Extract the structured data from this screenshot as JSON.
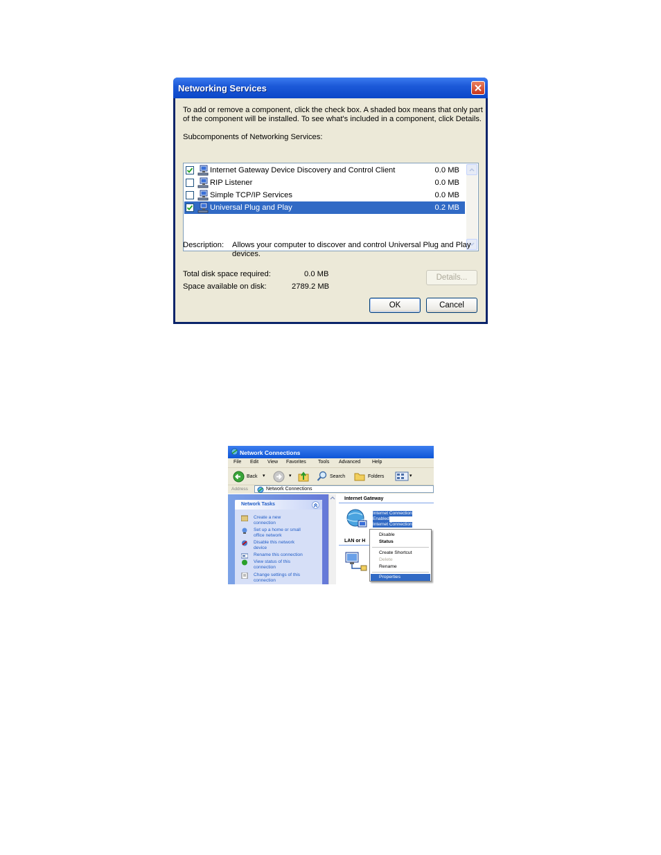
{
  "dialog": {
    "title": "Networking Services",
    "intro_line1": "To add or remove a component, click the check box. A shaded box means that only part",
    "intro_line2": "of the component will be installed. To see what's included in a component, click Details.",
    "subcomponents_label": "Subcomponents of Networking Services:",
    "components": [
      {
        "name": "Internet Gateway Device Discovery and Control Client",
        "size": "0.0 MB",
        "checked": true
      },
      {
        "name": "RIP Listener",
        "size": "0.0 MB",
        "checked": false
      },
      {
        "name": "Simple TCP/IP Services",
        "size": "0.0 MB",
        "checked": false
      },
      {
        "name": "Universal Plug and Play",
        "size": "0.2 MB",
        "checked": true
      }
    ],
    "description_label": "Description:",
    "description_line1": "Allows your computer to discover and control Universal Plug and Play",
    "description_line2": "devices.",
    "total_disk_label": "Total disk space required:",
    "total_disk_value": "0.0 MB",
    "space_available_label": "Space available on disk:",
    "space_available_value": "2789.2 MB",
    "details_button": "Details...",
    "ok_button": "OK",
    "cancel_button": "Cancel"
  },
  "network_connections": {
    "title": "Network Connections",
    "menu": [
      "File",
      "Edit",
      "View",
      "Favorites",
      "Tools",
      "Advanced",
      "Help"
    ],
    "toolbar": {
      "back": "Back",
      "search": "Search",
      "folders": "Folders"
    },
    "address_label": "Address",
    "address_value": "Network Connections",
    "tasks_header": "Network Tasks",
    "tasks": [
      {
        "line1": "Create a new",
        "line2": "connection"
      },
      {
        "line1": "Set up a home or small",
        "line2": "office network"
      },
      {
        "line1": "Disable this network",
        "line2": "device"
      },
      {
        "line1": "Rename this connection",
        "line2": ""
      },
      {
        "line1": "View status of this",
        "line2": "connection"
      },
      {
        "line1": "Change settings of this",
        "line2": "connection"
      }
    ],
    "group_internet_gateway": "Internet Gateway",
    "group_lan": "LAN or H",
    "gateway_item": {
      "line1": "Internet Connection",
      "line2": "Enabled",
      "line3": "Internet Connection"
    },
    "context_menu": [
      "Disable",
      "Status",
      "Create Shortcut",
      "Delete",
      "Rename",
      "Properties"
    ]
  }
}
